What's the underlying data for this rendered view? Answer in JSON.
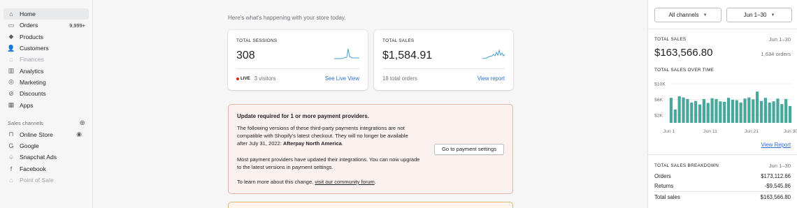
{
  "sidebar": {
    "items": [
      {
        "label": "Home",
        "icon": "home-icon",
        "active": true,
        "muted": false,
        "glyph": "⌂"
      },
      {
        "label": "Orders",
        "icon": "orders-icon",
        "count": "9,999+",
        "glyph": "▭"
      },
      {
        "label": "Products",
        "icon": "tag-icon",
        "glyph": "◆"
      },
      {
        "label": "Customers",
        "icon": "person-icon",
        "glyph": "👤"
      },
      {
        "label": "Finances",
        "icon": "bank-icon",
        "muted": true,
        "glyph": "⌂"
      },
      {
        "label": "Analytics",
        "icon": "bar-chart-icon",
        "glyph": "▥"
      },
      {
        "label": "Marketing",
        "icon": "target-icon",
        "glyph": "◎"
      },
      {
        "label": "Discounts",
        "icon": "discount-icon",
        "glyph": "⊘"
      },
      {
        "label": "Apps",
        "icon": "apps-icon",
        "glyph": "▦"
      }
    ],
    "sales_channels_title": "Sales channels",
    "channels": [
      {
        "label": "Online Store",
        "icon": "store-icon",
        "glyph": "⊓",
        "eye": true
      },
      {
        "label": "Google",
        "icon": "google-icon",
        "glyph": "G"
      },
      {
        "label": "Snapchat Ads",
        "icon": "snapchat-icon",
        "glyph": "♤"
      },
      {
        "label": "Facebook",
        "icon": "facebook-icon",
        "glyph": "f"
      },
      {
        "label": "Point of Sale",
        "icon": "pos-icon",
        "glyph": "⌂",
        "muted": true
      }
    ]
  },
  "main": {
    "greeting": "Here's what's happening with your store today.",
    "sessions": {
      "title": "TOTAL SESSIONS",
      "value": "308",
      "live_badge": "LIVE",
      "visitors": "3 visitors",
      "link": "See Live View"
    },
    "sales": {
      "title": "TOTAL SALES",
      "value": "$1,584.91",
      "orders": "18 total orders",
      "link": "View report"
    },
    "alert": {
      "title": "Update required for 1 or more payment providers.",
      "body_pre": "The following versions of these third-party payments integrations are not compatible with Shopify's latest checkout. They will no longer be available after July 31, 2022: ",
      "body_bold": "Afterpay North America",
      "body_post": ".",
      "body2": "Most payment providers have updated their integrations. You can now upgrade to the latest versions in payment settings.",
      "body3_pre": "To learn more about this change, ",
      "body3_link": "visit our community forum",
      "body3_post": ".",
      "button": "Go to payment settings"
    }
  },
  "right_panel": {
    "channel_select": "All channels",
    "date_select": "Jun 1–30",
    "total_sales_label": "TOTAL SALES",
    "total_sales_date": "Jun 1–30",
    "total_sales_value": "$163,566.80",
    "total_sales_orders": "1,634 orders",
    "over_time_label": "TOTAL SALES OVER TIME",
    "view_report": "View Report",
    "breakdown_label": "TOTAL SALES BREAKDOWN",
    "breakdown_date": "Jun 1–30",
    "breakdown_rows": [
      {
        "label": "Orders",
        "value": "$173,112.66"
      },
      {
        "label": "Returns",
        "value": "-$9,545.86"
      },
      {
        "label": "Total sales",
        "value": "$163,566.80"
      }
    ]
  },
  "chart_data": {
    "type": "bar",
    "title": "TOTAL SALES OVER TIME",
    "y_ticks": [
      "$10K",
      "$6K",
      "$2K"
    ],
    "x_ticks": [
      "Jun 1",
      "Jun 11",
      "Jun 21",
      "Jun 30"
    ],
    "ylim": [
      0,
      10000
    ],
    "color": "#47a89b",
    "values": [
      6400,
      3400,
      6800,
      6500,
      6100,
      5200,
      5600,
      4700,
      6100,
      5100,
      6300,
      6100,
      5500,
      5400,
      6400,
      5900,
      5800,
      5200,
      6200,
      6500,
      6000,
      8000,
      5600,
      6400,
      5200,
      5500,
      6200,
      4800,
      6100,
      4300
    ]
  },
  "colors": {
    "link": "#2c6ecb",
    "chart_bar": "#47a89b",
    "sparkline": "#47a0c9",
    "alert_bg": "#fbf2ef",
    "live_dot": "#d72c0d"
  }
}
